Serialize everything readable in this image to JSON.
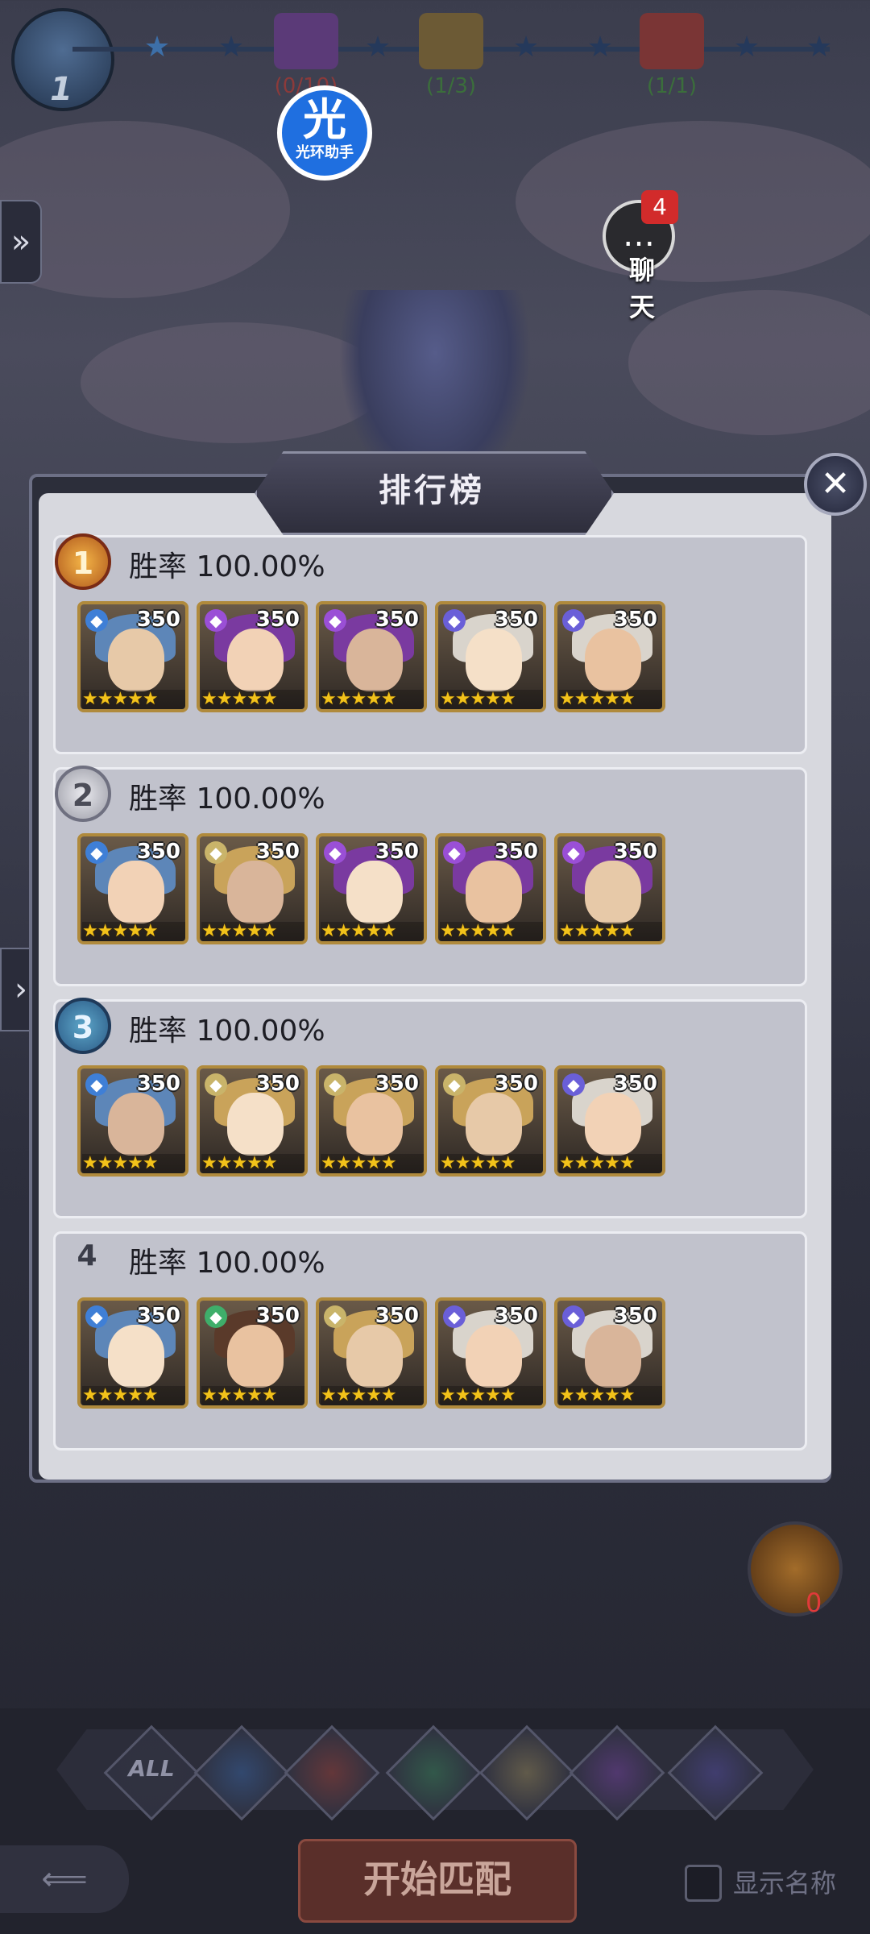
{
  "top_bar": {
    "level": "1",
    "chests": [
      {
        "count": "(0/10)",
        "color": "#8c3a3a"
      },
      {
        "count": "(1/3)",
        "color": "#3b6e3b"
      },
      {
        "count": "(1/1)",
        "color": "#3b6e3b"
      }
    ]
  },
  "helper": {
    "glyph": "光",
    "label": "光环助手"
  },
  "chat": {
    "label": "聊 天",
    "badge": "4",
    "icon": "chat-bubble-icon"
  },
  "leaderboard": {
    "title": "排行榜",
    "close_icon": "close-icon",
    "entries": [
      {
        "rank": "1",
        "medal": "gold",
        "win_rate": "胜率 100.00%",
        "heroes": [
          {
            "level": "350",
            "element": "water",
            "stars": "★★★★★"
          },
          {
            "level": "350",
            "element": "dark",
            "stars": "★★★★★"
          },
          {
            "level": "350",
            "element": "dark",
            "stars": "★★★★★"
          },
          {
            "level": "350",
            "element": "cosmic",
            "stars": "★★★★★"
          },
          {
            "level": "350",
            "element": "cosmic",
            "stars": "★★★★★"
          }
        ]
      },
      {
        "rank": "2",
        "medal": "silver",
        "win_rate": "胜率 100.00%",
        "heroes": [
          {
            "level": "350",
            "element": "water",
            "stars": "★★★★★"
          },
          {
            "level": "350",
            "element": "light",
            "stars": "★★★★★"
          },
          {
            "level": "350",
            "element": "dark",
            "stars": "★★★★★"
          },
          {
            "level": "350",
            "element": "dark",
            "stars": "★★★★★"
          },
          {
            "level": "350",
            "element": "dark",
            "stars": "★★★★★"
          }
        ]
      },
      {
        "rank": "3",
        "medal": "bronze",
        "win_rate": "胜率 100.00%",
        "heroes": [
          {
            "level": "350",
            "element": "water",
            "stars": "★★★★★"
          },
          {
            "level": "350",
            "element": "light",
            "stars": "★★★★★"
          },
          {
            "level": "350",
            "element": "light",
            "stars": "★★★★★"
          },
          {
            "level": "350",
            "element": "light",
            "stars": "★★★★★"
          },
          {
            "level": "350",
            "element": "cosmic",
            "stars": "★★★★★"
          }
        ]
      },
      {
        "rank": "4",
        "medal": "none",
        "win_rate": "胜率 100.00%",
        "heroes": [
          {
            "level": "350",
            "element": "water",
            "stars": "★★★★★"
          },
          {
            "level": "350",
            "element": "wind",
            "stars": "★★★★★"
          },
          {
            "level": "350",
            "element": "light",
            "stars": "★★★★★"
          },
          {
            "level": "350",
            "element": "cosmic",
            "stars": "★★★★★"
          },
          {
            "level": "350",
            "element": "cosmic",
            "stars": "★★★★★"
          }
        ]
      }
    ]
  },
  "filters": [
    {
      "label": "ALL",
      "icon": "all-filter-icon"
    },
    {
      "label": "",
      "icon": "water-element-icon"
    },
    {
      "label": "",
      "icon": "fire-element-icon"
    },
    {
      "label": "",
      "icon": "wind-element-icon"
    },
    {
      "label": "",
      "icon": "light-element-icon"
    },
    {
      "label": "",
      "icon": "dark-element-icon"
    },
    {
      "label": "",
      "icon": "cosmic-element-icon"
    }
  ],
  "bottom": {
    "start_match": "开始匹配",
    "show_names": "显示名称",
    "coin_count": "0"
  },
  "colors": {
    "water": "#3f7fd6",
    "dark": "#9a4fd6",
    "cosmic": "#6a5fd8",
    "light": "#c9b46a",
    "wind": "#3fae6a",
    "fire": "#d24b3a"
  }
}
